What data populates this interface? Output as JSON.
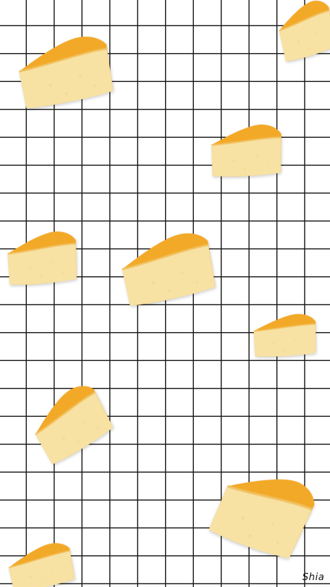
{
  "signature": "Shia",
  "colors": {
    "background": "#ffffff",
    "grid_line": "#1a1a1a",
    "cheese_body": "#f7e2a3",
    "cheese_rind": "#f3a928"
  },
  "cheese_pieces": [
    {
      "id": "c1"
    },
    {
      "id": "c2"
    },
    {
      "id": "c3"
    },
    {
      "id": "c4"
    },
    {
      "id": "c5"
    },
    {
      "id": "c6"
    },
    {
      "id": "c7"
    },
    {
      "id": "c8"
    },
    {
      "id": "c9"
    }
  ]
}
